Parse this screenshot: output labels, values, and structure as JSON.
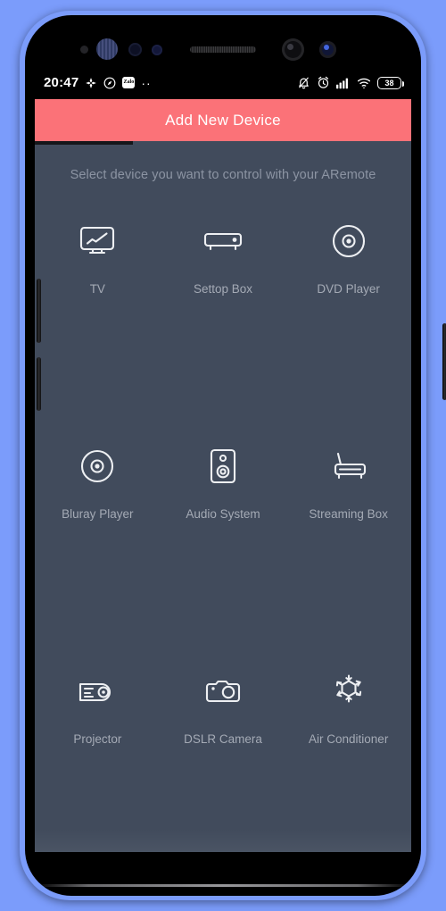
{
  "status_bar": {
    "time": "20:47",
    "left_icons": [
      "nav-arrows-icon",
      "compass-icon",
      "zalo-icon",
      "more-dots-icon"
    ],
    "zalo_label": "Zalo",
    "more_dots": "··",
    "right_icons": [
      "bell-muted-icon",
      "alarm-clock-icon",
      "signal-bars-icon",
      "wifi-icon"
    ],
    "battery_level": "38"
  },
  "app_bar": {
    "title": "Add New Device",
    "background": "#FB7278",
    "title_color": "#FFFFFF"
  },
  "progress": {
    "fill_percent": 26,
    "fill_color": "#15161A",
    "track_color": "#414B5C"
  },
  "main": {
    "subtitle": "Select device you want to control with your ARemote",
    "background": "#414B5C",
    "label_color": "#A4AAB5",
    "devices": [
      {
        "label": "TV",
        "icon": "tv-icon"
      },
      {
        "label": "Settop Box",
        "icon": "settop-box-icon"
      },
      {
        "label": "DVD Player",
        "icon": "disc-icon"
      },
      {
        "label": "Bluray Player",
        "icon": "disc-icon"
      },
      {
        "label": "Audio System",
        "icon": "speaker-icon"
      },
      {
        "label": "Streaming Box",
        "icon": "router-icon"
      },
      {
        "label": "Projector",
        "icon": "projector-icon"
      },
      {
        "label": "DSLR Camera",
        "icon": "camera-icon"
      },
      {
        "label": "Air Conditioner",
        "icon": "snowflake-gear-icon"
      }
    ]
  }
}
